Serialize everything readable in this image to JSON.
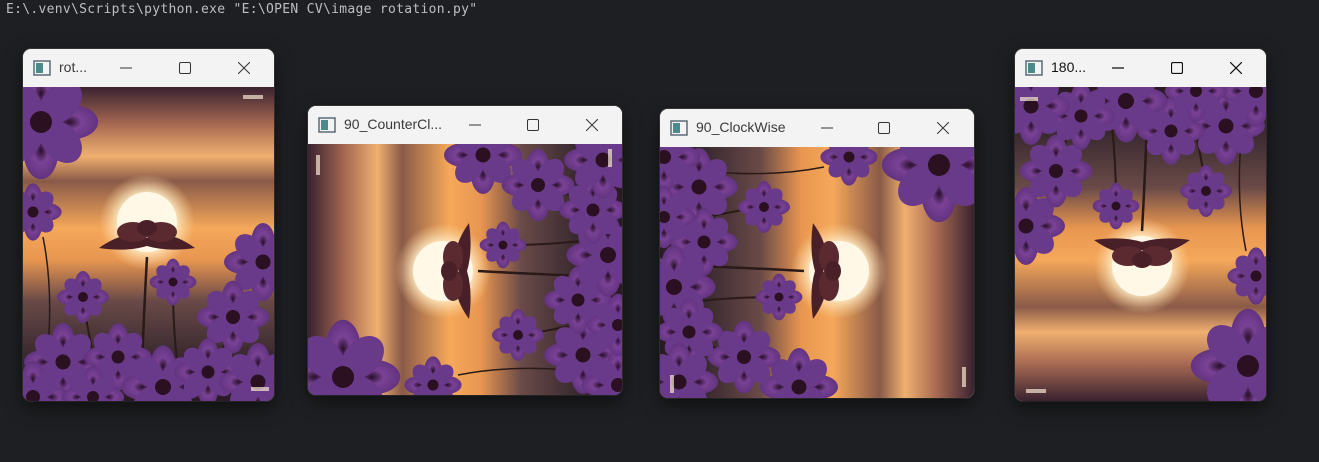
{
  "terminal": {
    "command": "E:\\.venv\\Scripts\\python.exe \"E:\\OPEN CV\\image rotation.py\""
  },
  "windows": [
    {
      "title": "rot...",
      "rotation": "original"
    },
    {
      "title": "90_CounterCl...",
      "rotation": "ccw"
    },
    {
      "title": "90_ClockWise",
      "rotation": "cw"
    },
    {
      "title": "180...",
      "rotation": "180"
    }
  ],
  "controls": {
    "minimize_icon": "minimize-icon",
    "maximize_icon": "maximize-icon",
    "close_icon": "close-icon"
  },
  "image": {
    "subject": "purple cosmos flowers silhouetted against sunset",
    "colors": {
      "sky_top": "#2a1a2a",
      "sky_glow": "#f0a860",
      "sun": "#fff4d8",
      "petal": "#6a3a8a",
      "petal_dark": "#3a1a4a",
      "stem": "#2a1a18"
    }
  }
}
